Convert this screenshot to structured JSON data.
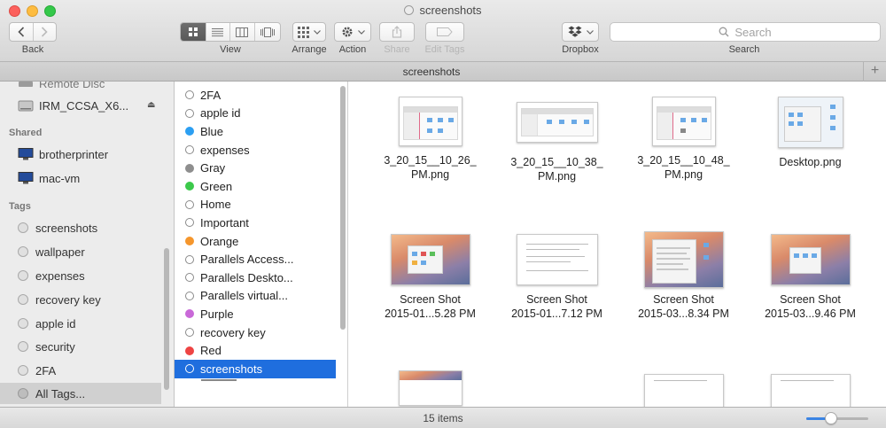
{
  "window": {
    "title": "screenshots"
  },
  "toolbar": {
    "back_label": "Back",
    "view_label": "View",
    "arrange_label": "Arrange",
    "action_label": "Action",
    "share_label": "Share",
    "edit_tags_label": "Edit Tags",
    "dropbox_label": "Dropbox",
    "search_label": "Search",
    "search_placeholder": "Search"
  },
  "tab": {
    "title": "screenshots",
    "add_symbol": "+"
  },
  "sidebar": {
    "partial_item": "Remote Disc",
    "device": "IRM_CCSA_X6...",
    "shared_header": "Shared",
    "shared": [
      "brotherprinter",
      "mac-vm"
    ],
    "tags_header": "Tags",
    "tags": [
      "screenshots",
      "wallpaper",
      "expenses",
      "recovery key",
      "apple id",
      "security",
      "2FA",
      "All Tags..."
    ]
  },
  "taglist": {
    "items": [
      {
        "label": "2FA",
        "color": ""
      },
      {
        "label": "apple id",
        "color": ""
      },
      {
        "label": "Blue",
        "color": "#2c9ff2"
      },
      {
        "label": "expenses",
        "color": ""
      },
      {
        "label": "Gray",
        "color": "#8e8e8e"
      },
      {
        "label": "Green",
        "color": "#3cc94b"
      },
      {
        "label": "Home",
        "color": ""
      },
      {
        "label": "Important",
        "color": ""
      },
      {
        "label": "Orange",
        "color": "#f5962c"
      },
      {
        "label": "Parallels Access...",
        "color": ""
      },
      {
        "label": "Parallels Deskto...",
        "color": ""
      },
      {
        "label": "Parallels virtual...",
        "color": ""
      },
      {
        "label": "Purple",
        "color": "#c969d8"
      },
      {
        "label": "recovery key",
        "color": ""
      },
      {
        "label": "Red",
        "color": "#ee4443"
      },
      {
        "label": "screenshots",
        "color": ""
      }
    ],
    "selected": "screenshots"
  },
  "files": [
    {
      "name_line1": "3_20_15__10_26_",
      "name_line2": "PM.png",
      "thumb": "finder"
    },
    {
      "name_line1": "3_20_15__10_38_",
      "name_line2": "PM.png",
      "thumb": "finder-wide"
    },
    {
      "name_line1": "3_20_15__10_48_",
      "name_line2": "PM.png",
      "thumb": "finder"
    },
    {
      "name_line1": "Desktop.png",
      "name_line2": "",
      "thumb": "desktop"
    },
    {
      "name_line1": "Screen Shot",
      "name_line2": "2015-01...5.28 PM",
      "thumb": "yosemite"
    },
    {
      "name_line1": "Screen Shot",
      "name_line2": "2015-01...7.12 PM",
      "thumb": "document"
    },
    {
      "name_line1": "Screen Shot",
      "name_line2": "2015-03...8.34 PM",
      "thumb": "yosemite-list"
    },
    {
      "name_line1": "Screen Shot",
      "name_line2": "2015-03...9.46 PM",
      "thumb": "yosemite"
    }
  ],
  "status": {
    "item_count": "15 items",
    "zoom_fraction": 0.4
  }
}
